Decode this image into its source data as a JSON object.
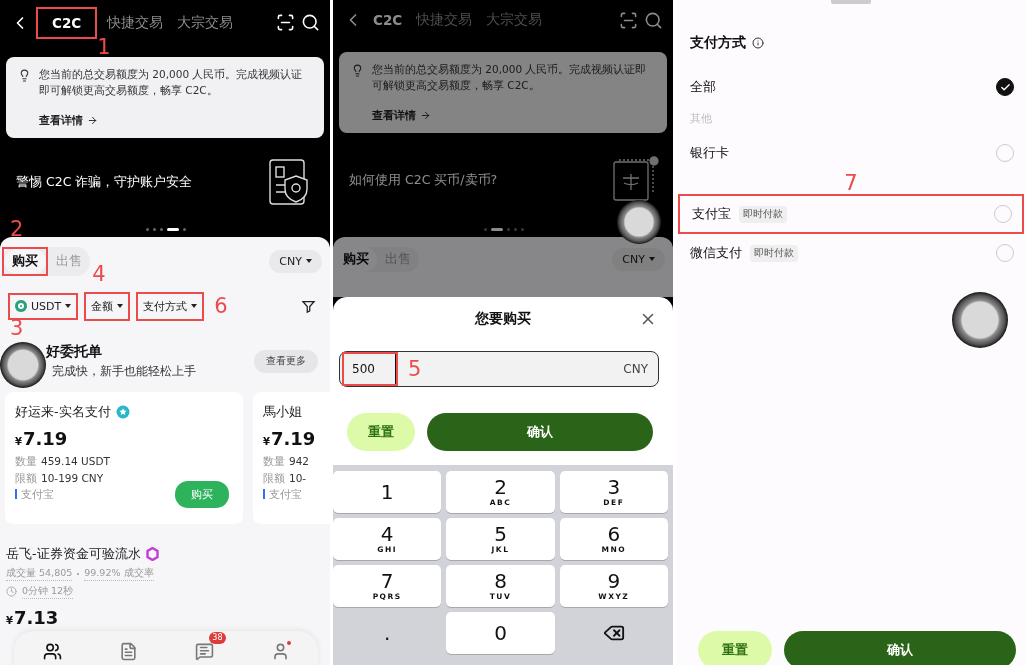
{
  "market_screen": {
    "nav": {
      "tabs": [
        {
          "label": "C2C",
          "selected": true,
          "marker": "1"
        },
        {
          "label": "快捷交易",
          "selected": false
        },
        {
          "label": "大宗交易",
          "selected": false
        }
      ]
    },
    "notice": {
      "text": "您当前的总交易额度为 20,000 人民币。完成视频认证即可解锁更高交易额度，畅享 C2C。",
      "link": "查看详情"
    },
    "banner": {
      "text": "警惕 C2C 诈骗，守护账户安全",
      "illustration": {
        "kind": "shield"
      },
      "pages": [
        {
          "selected": false
        },
        {
          "selected": false
        },
        {
          "selected": false
        },
        {
          "selected": true
        },
        {
          "selected": false
        }
      ]
    },
    "trade_tabs": {
      "tabs": [
        {
          "label": "购买",
          "selected": true,
          "marker": "2"
        },
        {
          "label": "出售",
          "selected": false
        }
      ],
      "currency": "CNY"
    },
    "filters": [
      {
        "kind": "coin",
        "label": "USDT",
        "marker": "3"
      },
      {
        "kind": "plain",
        "label": "金额",
        "marker": "4"
      },
      {
        "kind": "plain",
        "label": "支付方式",
        "marker": "6"
      }
    ],
    "featured": {
      "title": "好委托单",
      "subtitle": "完成快，新手也能轻松上手",
      "more": "查看更多",
      "cards": [
        {
          "name": "好运来-实名支付",
          "badge": {
            "kind": "verified"
          },
          "currency": "¥",
          "price": "7.19",
          "quantity_label": "数量",
          "quantity": "459.14 USDT",
          "limit_label": "限额",
          "limit": "10-199 CNY",
          "payment": "支付宝",
          "action": "购买"
        },
        {
          "name": "馬小姐",
          "currency": "¥",
          "price": "7.19",
          "quantity_label": "数量",
          "quantity": "942",
          "limit_label": "限额",
          "limit": "10-",
          "payment": "支付宝"
        }
      ]
    },
    "listing": {
      "name": "岳飞-证券资金可验流水",
      "badge": {
        "kind": "merchant"
      },
      "stats": [
        "成交量 54,805",
        "99.92% 成交率"
      ],
      "time": "0分钟 12秒",
      "currency": "¥",
      "price": "7.13"
    },
    "bottom_nav": [
      {
        "kind": "people",
        "selected": true,
        "alert": false
      },
      {
        "kind": "orders",
        "selected": false,
        "alert": false
      },
      {
        "kind": "messages",
        "selected": false,
        "alert": false,
        "badge": "38"
      },
      {
        "kind": "profile",
        "selected": false,
        "alert": true
      }
    ]
  },
  "amount_screen": {
    "nav": {
      "tabs": [
        {
          "label": "C2C",
          "selected": true
        },
        {
          "label": "快捷交易",
          "selected": false
        },
        {
          "label": "大宗交易",
          "selected": false
        }
      ]
    },
    "notice": {
      "text": "您当前的总交易额度为 20,000 人民币。完成视频认证即可解锁更高交易额度，畅享 C2C。",
      "link": "查看详情"
    },
    "banner": {
      "text": "如何使用 C2C 买币/卖币?",
      "illustration": {
        "kind": "coin"
      },
      "pages": [
        {
          "selected": false
        },
        {
          "selected": true
        },
        {
          "selected": false
        },
        {
          "selected": false
        },
        {
          "selected": false
        }
      ]
    },
    "trade_tabs": {
      "tabs": [
        {
          "label": "购买",
          "selected": true
        },
        {
          "label": "出售",
          "selected": false
        }
      ],
      "currency": "CNY"
    },
    "sheet": {
      "title": "您要购买",
      "input": {
        "value": "500",
        "unit": "CNY",
        "marker": "5"
      },
      "reset": "重置",
      "confirm": "确认",
      "keys": [
        {
          "kind": "digit",
          "digit": "1"
        },
        {
          "kind": "digit",
          "digit": "2",
          "letters": "ABC"
        },
        {
          "kind": "digit",
          "digit": "3",
          "letters": "DEF"
        },
        {
          "kind": "digit",
          "digit": "4",
          "letters": "GHI"
        },
        {
          "kind": "digit",
          "digit": "5",
          "letters": "JKL"
        },
        {
          "kind": "digit",
          "digit": "6",
          "letters": "MNO"
        },
        {
          "kind": "digit",
          "digit": "7",
          "letters": "PQRS"
        },
        {
          "kind": "digit",
          "digit": "8",
          "letters": "TUV"
        },
        {
          "kind": "digit",
          "digit": "9",
          "letters": "WXYZ"
        },
        {
          "kind": "symbol",
          "digit": "."
        },
        {
          "kind": "digit",
          "digit": "0"
        },
        {
          "kind": "backspace"
        }
      ]
    }
  },
  "payment_screen": {
    "title": "支付方式",
    "options": [
      {
        "kind": "option",
        "label": "全部",
        "selected": true
      },
      {
        "kind": "section",
        "label": "其他"
      },
      {
        "kind": "option",
        "label": "银行卡",
        "selected": false
      },
      {
        "kind": "option",
        "label": "支付宝",
        "tag": "即时付款",
        "selected": false,
        "marker": "7"
      },
      {
        "kind": "option",
        "label": "微信支付",
        "tag": "即时付款",
        "selected": false
      }
    ],
    "reset": "重置",
    "confirm": "确认"
  }
}
